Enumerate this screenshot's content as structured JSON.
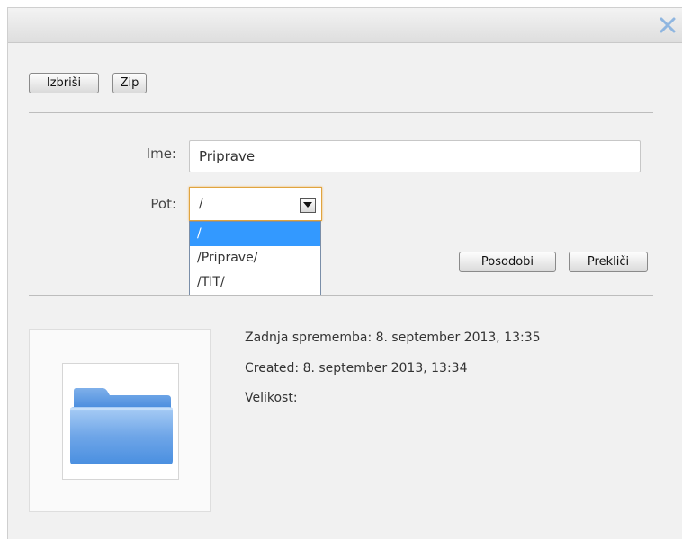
{
  "toolbar": {
    "delete_label": "Izbriši",
    "zip_label": "Zip"
  },
  "form": {
    "name_label": "Ime:",
    "name_value": "Priprave",
    "path_label": "Pot:",
    "path_value": "/",
    "path_options": [
      "/",
      "/Priprave/",
      "/TIT/"
    ],
    "path_selected_index": 0,
    "update_label": "Posodobi",
    "cancel_label": "Prekliči"
  },
  "details": {
    "modified": "Zadnja sprememba: 8. september 2013, 13:35",
    "created": "Created: 8. september 2013, 13:34",
    "size": "Velikost:"
  },
  "icons": {
    "close": "close-icon",
    "dropdown": "chevron-down-icon",
    "preview": "folder-icon"
  },
  "colors": {
    "dialog_bg": "#f1f1f1",
    "close_icon": "#8fb6e0",
    "focus_border": "#e0a43f",
    "selected_option": "#3399ff",
    "folder": "#6fa6e8"
  }
}
